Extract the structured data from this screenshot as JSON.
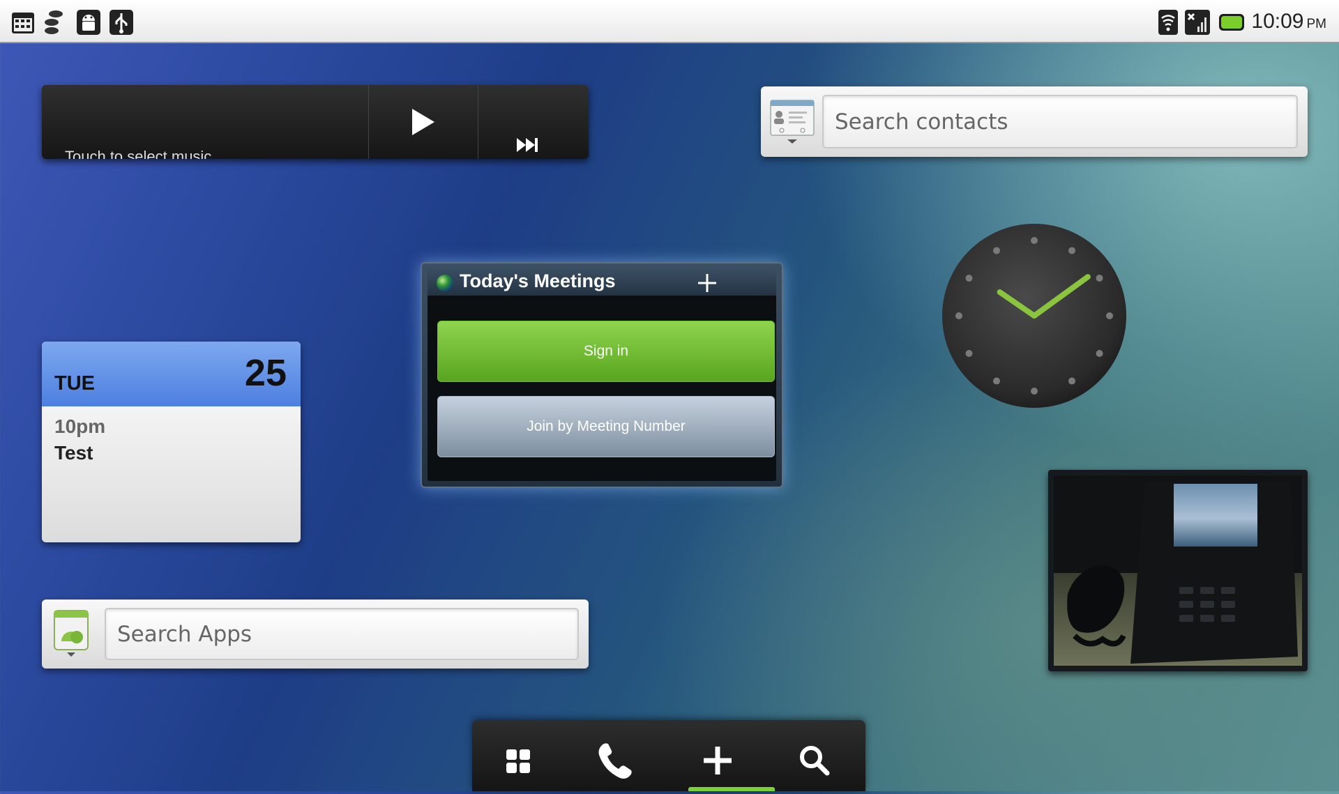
{
  "status_bar": {
    "time": "10:09",
    "ampm": "PM",
    "left_icons": [
      "calendar-icon",
      "sync-icon",
      "android-icon",
      "usb-icon"
    ],
    "right_icons": [
      "wifi-icon",
      "signal-icon",
      "battery-icon"
    ]
  },
  "music_widget": {
    "track_text": "Touch to select music",
    "play_icon": "play-icon",
    "next_icon": "next-track-icon"
  },
  "contacts_search": {
    "placeholder": "Search contacts",
    "icon": "contacts-icon"
  },
  "calendar_widget": {
    "day_of_week": "TUE",
    "day": "25",
    "event_time": "10pm",
    "event_title": "Test",
    "header_color": "#5e8de6"
  },
  "meetings_widget": {
    "title": "Today's Meetings",
    "sign_in_label": "Sign in",
    "join_label": "Join by Meeting Number",
    "sign_in_color": "#6cb92e",
    "join_color": "#9aa9b8"
  },
  "clock_widget": {
    "time": "10:09",
    "hand_color": "#8bc53f"
  },
  "apps_search": {
    "placeholder": "Search Apps",
    "icon": "android-market-icon"
  },
  "photo_frame": {
    "description_icon": "photo-icon"
  },
  "dock": {
    "items": [
      "apps-grid-icon",
      "phone-icon",
      "add-icon",
      "search-icon"
    ],
    "accent": "#7cd13b"
  }
}
